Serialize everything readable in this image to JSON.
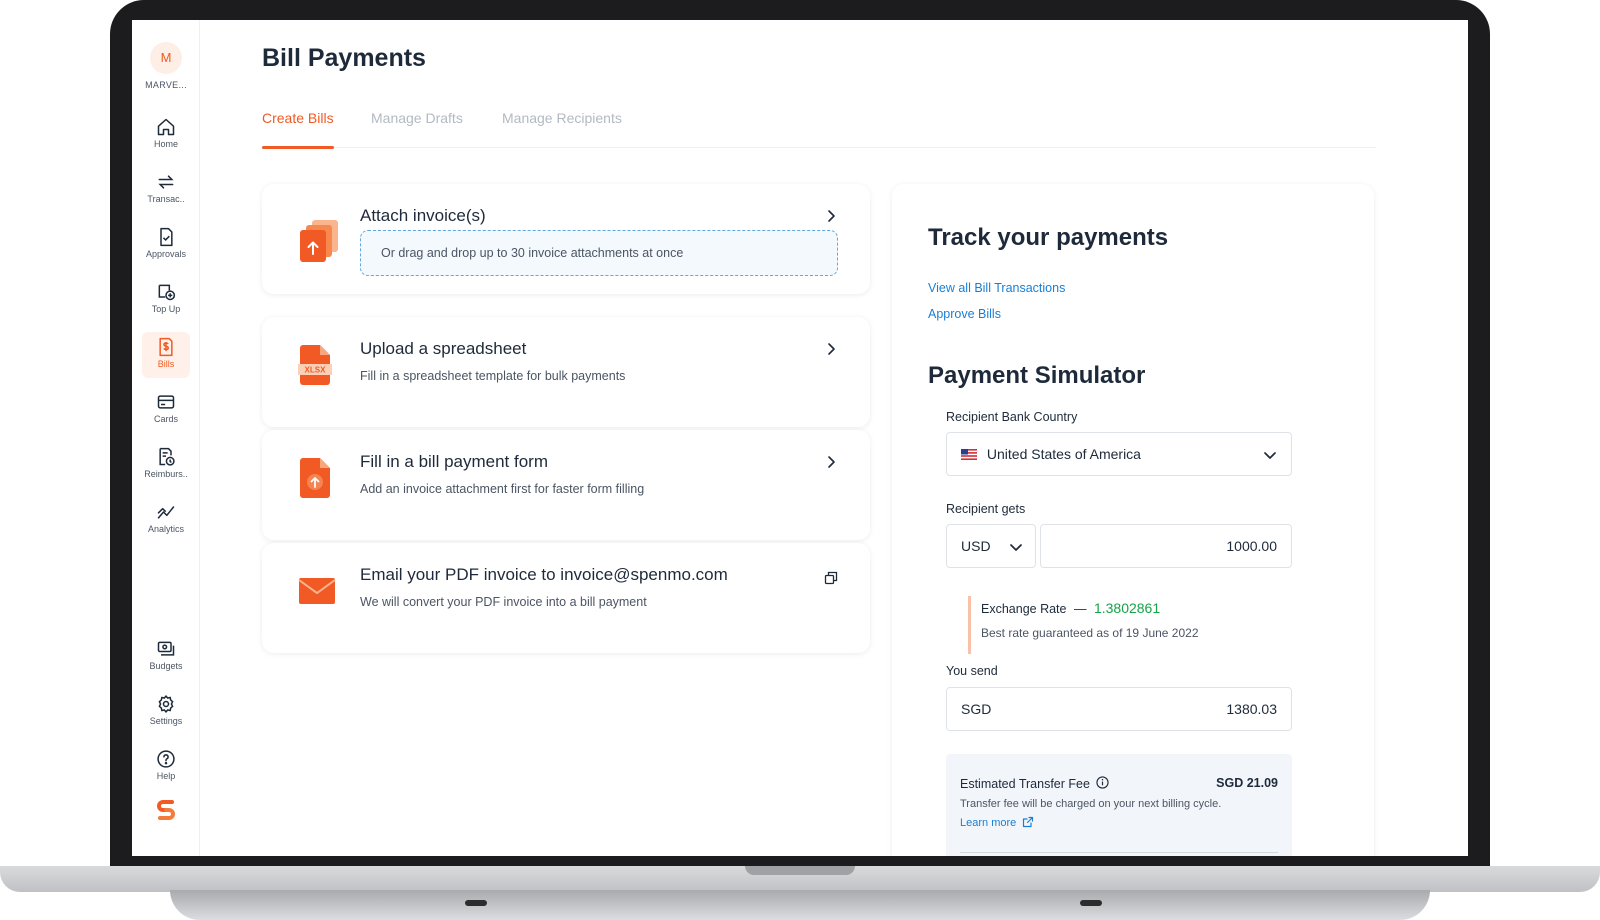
{
  "sidebar": {
    "org_initial": "M",
    "org_name": "MARVE...",
    "items": [
      {
        "label": "Home",
        "icon": "home-icon"
      },
      {
        "label": "Transac..",
        "icon": "transfer-arrows-icon"
      },
      {
        "label": "Approvals",
        "icon": "document-check-icon"
      },
      {
        "label": "Top Up",
        "icon": "top-up-icon"
      },
      {
        "label": "Bills",
        "icon": "bill-dollar-icon",
        "active": true
      },
      {
        "label": "Cards",
        "icon": "card-icon"
      },
      {
        "label": "Reimburs..",
        "icon": "reimburse-icon"
      },
      {
        "label": "Analytics",
        "icon": "analytics-chart-icon"
      }
    ],
    "bottom_items": [
      {
        "label": "Budgets",
        "icon": "budgets-icon"
      },
      {
        "label": "Settings",
        "icon": "gear-icon"
      },
      {
        "label": "Help",
        "icon": "help-icon"
      }
    ],
    "brand_icon": "spenmo-logo-icon"
  },
  "page": {
    "title": "Bill Payments",
    "tabs": [
      "Create Bills",
      "Manage Drafts",
      "Manage Recipients"
    ],
    "active_tab": "Create Bills"
  },
  "cards": [
    {
      "title": "Attach invoice(s)",
      "drop_text": "Or drag and drop up to 30 invoice attachments at once",
      "icon": "attach-files-icon"
    },
    {
      "title": "Upload a spreadsheet",
      "subtitle": "Fill in a spreadsheet template for bulk payments",
      "icon": "xlsx-file-icon",
      "icon_text": "XLSX"
    },
    {
      "title": "Fill in a bill payment form",
      "subtitle": "Add an invoice attachment first for faster form filling",
      "icon": "upload-file-icon"
    },
    {
      "title": "Email your PDF invoice to invoice@spenmo.com",
      "subtitle": "We will convert your PDF invoice into a bill payment",
      "icon": "envelope-icon"
    }
  ],
  "panel": {
    "track_title": "Track your payments",
    "link_transactions": "View all Bill Transactions",
    "link_approve": "Approve Bills",
    "simulator_title": "Payment Simulator",
    "country_label": "Recipient Bank Country",
    "country_value": "United States of America",
    "recipient_gets_label": "Recipient gets",
    "recipient_currency": "USD",
    "recipient_amount": "1000.00",
    "exchange_label": "Exchange Rate",
    "exchange_dash": "—",
    "exchange_value": "1.3802861",
    "exchange_note": "Best rate guaranteed as of 19 June 2022",
    "you_send_label": "You send",
    "send_currency": "SGD",
    "send_amount": "1380.03",
    "fee_label": "Estimated Transfer Fee",
    "fee_value": "SGD 21.09",
    "fee_note": "Transfer fee will be charged on your next billing cycle.",
    "learn_more": "Learn more"
  },
  "colors": {
    "accent": "#f15a24",
    "link": "#1a7fd4",
    "rate": "#16a34a"
  }
}
